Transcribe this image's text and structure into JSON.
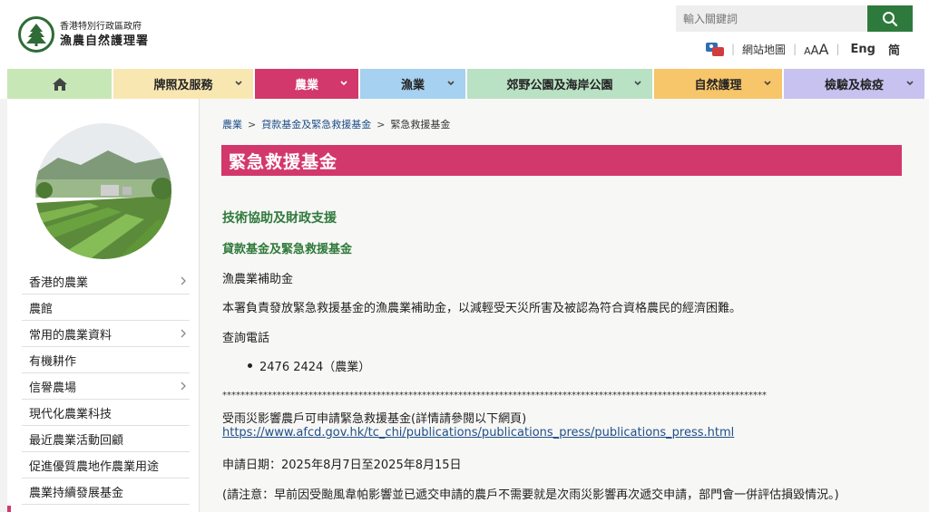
{
  "header": {
    "logo_line1": "香港特別行政區政府",
    "logo_line2": "漁農自然護理署",
    "search_placeholder": "輸入關鍵詞",
    "sitemap": "網站地圖",
    "font_a_small": "A",
    "font_a_mid": "A",
    "font_a_big": "A",
    "lang_eng": "Eng",
    "lang_sc": "简"
  },
  "nav": {
    "home_icon": "home-icon",
    "items": [
      {
        "label": "牌照及服務"
      },
      {
        "label": "農業"
      },
      {
        "label": "漁業"
      },
      {
        "label": "郊野公園及海岸公園"
      },
      {
        "label": "自然護理"
      },
      {
        "label": "檢驗及檢疫"
      }
    ]
  },
  "sidebar": {
    "items": [
      {
        "label": "香港的農業"
      },
      {
        "label": "農館"
      },
      {
        "label": "常用的農業資料"
      },
      {
        "label": "有機耕作"
      },
      {
        "label": "信譽農場"
      },
      {
        "label": "現代化農業科技"
      },
      {
        "label": "最近農業活動回顧"
      },
      {
        "label": "促進優質農地作農業用途"
      },
      {
        "label": "農業持續發展基金"
      }
    ]
  },
  "breadcrumb": {
    "items": [
      "農業",
      "貸款基金及緊急救援基金",
      "緊急救援基金"
    ],
    "sep": ">"
  },
  "main": {
    "title": "緊急救援基金",
    "heading1": "技術協助及財政支援",
    "heading2": "貸款基金及緊急救援基金",
    "subheading": "漁農業補助金",
    "desc": "本署負責發放緊急救援基金的漁農業補助金，以減輕受天災所害及被認為符合資格農民的經濟困難。",
    "enquiry_label": "查詢電話",
    "phone": "2476 2424（農業）",
    "stars": "************************************************************************************************************************",
    "notice": "受雨災影響農戶可申請緊急救援基金(詳情請參閱以下網頁)",
    "link": "https://www.afcd.gov.hk/tc_chi/publications/publications_press/publications_press.html",
    "apply_date": "申請日期：2025年8月7日至2025年8月15日",
    "note": "(請注意：早前因受颱風韋帕影響並已遞交申請的農戶不需要就是次雨災影響再次遞交申請，部門會一併評估損毀情況。)"
  },
  "colors": {
    "accent_pink": "#d2386c",
    "green_heading": "#2f7a3b",
    "link_blue": "#1f4e8a",
    "search_green": "#2d7a3c"
  }
}
